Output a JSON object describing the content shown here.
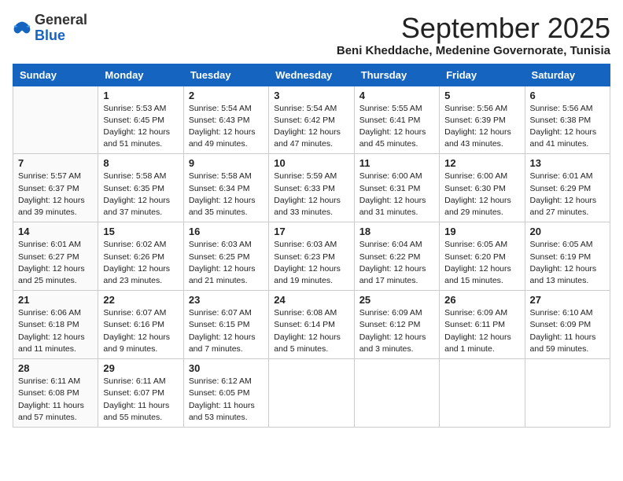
{
  "app": {
    "name_general": "General",
    "name_blue": "Blue"
  },
  "header": {
    "month": "September 2025",
    "location": "Beni Kheddache, Medenine Governorate, Tunisia"
  },
  "columns": [
    "Sunday",
    "Monday",
    "Tuesday",
    "Wednesday",
    "Thursday",
    "Friday",
    "Saturday"
  ],
  "weeks": [
    [
      {
        "num": "",
        "content": ""
      },
      {
        "num": "1",
        "content": "Sunrise: 5:53 AM\nSunset: 6:45 PM\nDaylight: 12 hours\nand 51 minutes."
      },
      {
        "num": "2",
        "content": "Sunrise: 5:54 AM\nSunset: 6:43 PM\nDaylight: 12 hours\nand 49 minutes."
      },
      {
        "num": "3",
        "content": "Sunrise: 5:54 AM\nSunset: 6:42 PM\nDaylight: 12 hours\nand 47 minutes."
      },
      {
        "num": "4",
        "content": "Sunrise: 5:55 AM\nSunset: 6:41 PM\nDaylight: 12 hours\nand 45 minutes."
      },
      {
        "num": "5",
        "content": "Sunrise: 5:56 AM\nSunset: 6:39 PM\nDaylight: 12 hours\nand 43 minutes."
      },
      {
        "num": "6",
        "content": "Sunrise: 5:56 AM\nSunset: 6:38 PM\nDaylight: 12 hours\nand 41 minutes."
      }
    ],
    [
      {
        "num": "7",
        "content": "Sunrise: 5:57 AM\nSunset: 6:37 PM\nDaylight: 12 hours\nand 39 minutes."
      },
      {
        "num": "8",
        "content": "Sunrise: 5:58 AM\nSunset: 6:35 PM\nDaylight: 12 hours\nand 37 minutes."
      },
      {
        "num": "9",
        "content": "Sunrise: 5:58 AM\nSunset: 6:34 PM\nDaylight: 12 hours\nand 35 minutes."
      },
      {
        "num": "10",
        "content": "Sunrise: 5:59 AM\nSunset: 6:33 PM\nDaylight: 12 hours\nand 33 minutes."
      },
      {
        "num": "11",
        "content": "Sunrise: 6:00 AM\nSunset: 6:31 PM\nDaylight: 12 hours\nand 31 minutes."
      },
      {
        "num": "12",
        "content": "Sunrise: 6:00 AM\nSunset: 6:30 PM\nDaylight: 12 hours\nand 29 minutes."
      },
      {
        "num": "13",
        "content": "Sunrise: 6:01 AM\nSunset: 6:29 PM\nDaylight: 12 hours\nand 27 minutes."
      }
    ],
    [
      {
        "num": "14",
        "content": "Sunrise: 6:01 AM\nSunset: 6:27 PM\nDaylight: 12 hours\nand 25 minutes."
      },
      {
        "num": "15",
        "content": "Sunrise: 6:02 AM\nSunset: 6:26 PM\nDaylight: 12 hours\nand 23 minutes."
      },
      {
        "num": "16",
        "content": "Sunrise: 6:03 AM\nSunset: 6:25 PM\nDaylight: 12 hours\nand 21 minutes."
      },
      {
        "num": "17",
        "content": "Sunrise: 6:03 AM\nSunset: 6:23 PM\nDaylight: 12 hours\nand 19 minutes."
      },
      {
        "num": "18",
        "content": "Sunrise: 6:04 AM\nSunset: 6:22 PM\nDaylight: 12 hours\nand 17 minutes."
      },
      {
        "num": "19",
        "content": "Sunrise: 6:05 AM\nSunset: 6:20 PM\nDaylight: 12 hours\nand 15 minutes."
      },
      {
        "num": "20",
        "content": "Sunrise: 6:05 AM\nSunset: 6:19 PM\nDaylight: 12 hours\nand 13 minutes."
      }
    ],
    [
      {
        "num": "21",
        "content": "Sunrise: 6:06 AM\nSunset: 6:18 PM\nDaylight: 12 hours\nand 11 minutes."
      },
      {
        "num": "22",
        "content": "Sunrise: 6:07 AM\nSunset: 6:16 PM\nDaylight: 12 hours\nand 9 minutes."
      },
      {
        "num": "23",
        "content": "Sunrise: 6:07 AM\nSunset: 6:15 PM\nDaylight: 12 hours\nand 7 minutes."
      },
      {
        "num": "24",
        "content": "Sunrise: 6:08 AM\nSunset: 6:14 PM\nDaylight: 12 hours\nand 5 minutes."
      },
      {
        "num": "25",
        "content": "Sunrise: 6:09 AM\nSunset: 6:12 PM\nDaylight: 12 hours\nand 3 minutes."
      },
      {
        "num": "26",
        "content": "Sunrise: 6:09 AM\nSunset: 6:11 PM\nDaylight: 12 hours\nand 1 minute."
      },
      {
        "num": "27",
        "content": "Sunrise: 6:10 AM\nSunset: 6:09 PM\nDaylight: 11 hours\nand 59 minutes."
      }
    ],
    [
      {
        "num": "28",
        "content": "Sunrise: 6:11 AM\nSunset: 6:08 PM\nDaylight: 11 hours\nand 57 minutes."
      },
      {
        "num": "29",
        "content": "Sunrise: 6:11 AM\nSunset: 6:07 PM\nDaylight: 11 hours\nand 55 minutes."
      },
      {
        "num": "30",
        "content": "Sunrise: 6:12 AM\nSunset: 6:05 PM\nDaylight: 11 hours\nand 53 minutes."
      },
      {
        "num": "",
        "content": ""
      },
      {
        "num": "",
        "content": ""
      },
      {
        "num": "",
        "content": ""
      },
      {
        "num": "",
        "content": ""
      }
    ]
  ]
}
